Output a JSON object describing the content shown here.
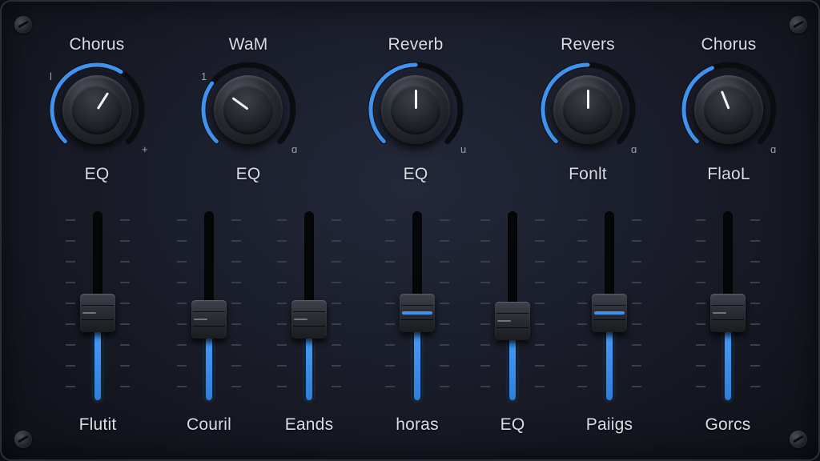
{
  "colors": {
    "accent": "#3f93ee",
    "panel": "#1b1f2b",
    "text": "#d9dde6"
  },
  "knobs": [
    {
      "top_label": "Chorus",
      "bottom_label": "EQ",
      "min_mark": "l",
      "max_mark": "+",
      "value": 0.62
    },
    {
      "top_label": "WaM",
      "bottom_label": "EQ",
      "min_mark": "1",
      "max_mark": "ɑ",
      "value": 0.3
    },
    {
      "top_label": "Reverb",
      "bottom_label": "EQ",
      "min_mark": "",
      "max_mark": "u",
      "value": 0.5
    },
    {
      "top_label": "Revers",
      "bottom_label": "Fonlt",
      "min_mark": "",
      "max_mark": "ɑ",
      "value": 0.5
    },
    {
      "top_label": "Chorus",
      "bottom_label": "FlaoL",
      "min_mark": "",
      "max_mark": "ɑ",
      "value": 0.42
    }
  ],
  "faders": [
    {
      "label": "Flutit",
      "value": 0.46,
      "accent_line": false
    },
    {
      "label": "Couril",
      "value": 0.43,
      "accent_line": false
    },
    {
      "label": "Eands",
      "value": 0.43,
      "accent_line": false
    },
    {
      "label": "horas",
      "value": 0.46,
      "accent_line": true
    },
    {
      "label": "EQ",
      "value": 0.42,
      "accent_line": false
    },
    {
      "label": "Paiigs",
      "value": 0.46,
      "accent_line": true
    },
    {
      "label": "Gorcs",
      "value": 0.46,
      "accent_line": false
    }
  ]
}
